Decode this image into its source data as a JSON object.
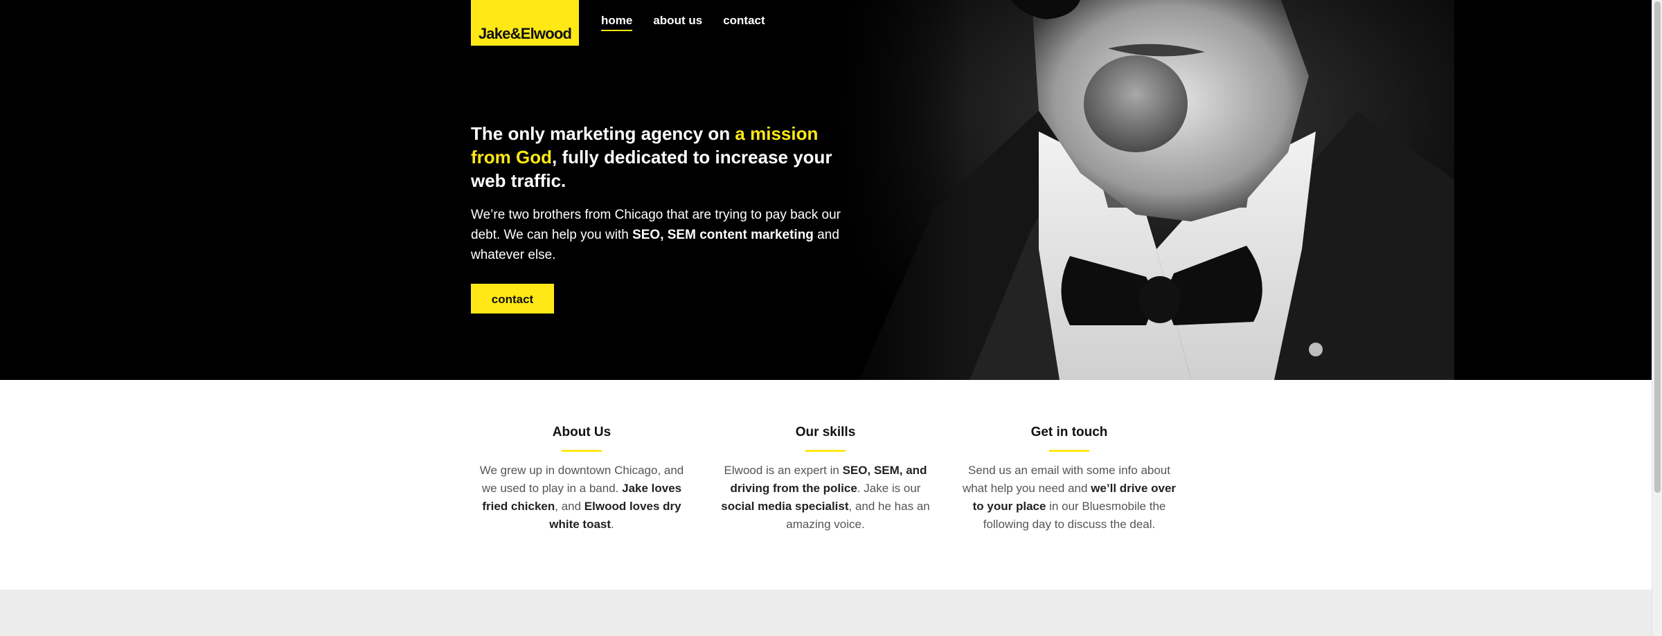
{
  "brand": {
    "logo": "Jake&Elwood",
    "accent": "#ffe816"
  },
  "nav": {
    "home": "home",
    "about": "about us",
    "contact": "contact"
  },
  "hero": {
    "headline_pre": "The only marketing agency on ",
    "headline_highlight": "a mission from God",
    "headline_post": ", fully dedicated to increase your web traffic.",
    "lead_pre": "We’re two brothers from Chicago that are trying to pay back our debt. We can help you with ",
    "lead_bold": "SEO, SEM content marketing",
    "lead_post": " and whatever else.",
    "cta": "contact"
  },
  "features": [
    {
      "title": "About Us",
      "t1": "We grew up in downtown Chicago, and we used to play in a band. ",
      "b1": "Jake loves fried chicken",
      "t2": ", and ",
      "b2": "Elwood loves dry white toast",
      "t3": "."
    },
    {
      "title": "Our skills",
      "t1": "Elwood is an expert in ",
      "b1": "SEO, SEM, and driving from the police",
      "t2": ". Jake is our ",
      "b2": "social media specialist",
      "t3": ", and he has an amazing voice."
    },
    {
      "title": "Get in touch",
      "t1": "Send us an email with some info about what help you need and ",
      "b1": "we’ll drive over to your place",
      "t2": " in our Bluesmobile the following day to discuss the deal.",
      "b2": "",
      "t3": ""
    }
  ]
}
